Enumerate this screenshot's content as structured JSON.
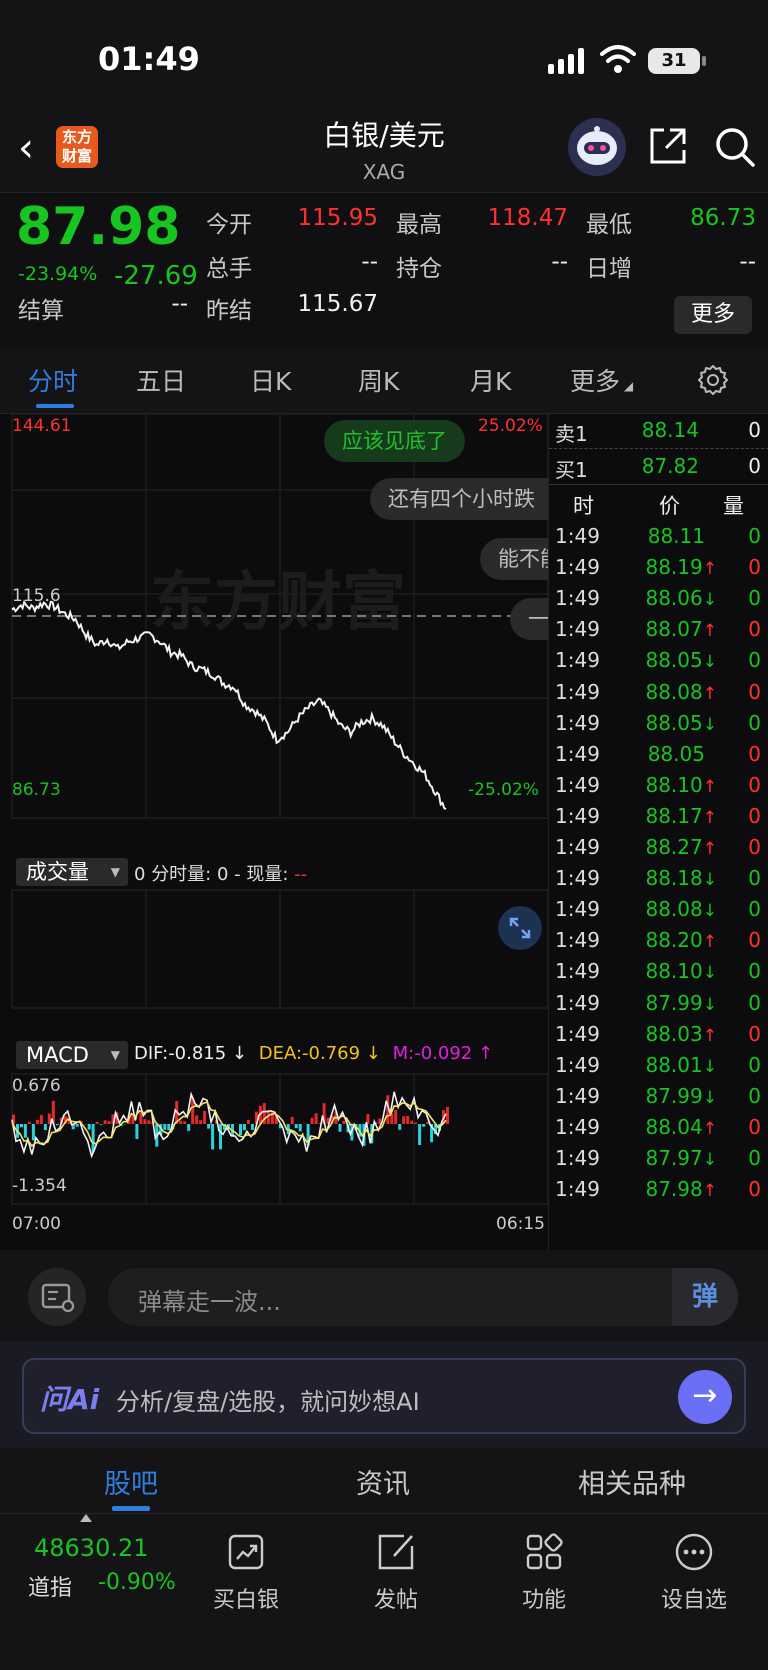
{
  "status_bar": {
    "time": "01:49",
    "battery": "31"
  },
  "header": {
    "logo_text": "东方财富",
    "title": "白银/美元",
    "subtitle": "XAG"
  },
  "quote": {
    "price": "87.98",
    "change_pct": "-23.94%",
    "change": "-27.69",
    "fields": {
      "open_label": "今开",
      "open": "115.95",
      "high_label": "最高",
      "high": "118.47",
      "low_label": "最低",
      "low": "86.73",
      "volume_label": "总手",
      "volume": "--",
      "oi_label": "持仓",
      "oi": "--",
      "daily_inc_label": "日增",
      "daily_inc": "--",
      "settle_label": "结算",
      "settle": "--",
      "prev_settle_label": "昨结",
      "prev_settle": "115.67"
    },
    "more_label": "更多"
  },
  "tabs": {
    "items": [
      "分时",
      "五日",
      "日K",
      "周K",
      "月K",
      "更多"
    ],
    "active": "分时"
  },
  "chart": {
    "top_price": "144.61",
    "top_pct": "25.02%",
    "ref_price": "115.6",
    "bottom_price": "86.73",
    "bottom_pct": "-25.02%",
    "watermark": "东方财富",
    "danmu": [
      "应该见底了",
      "还有四个小时跌",
      "能不能",
      "一"
    ],
    "volume_label": "成交量",
    "volume_info_prefix": "0",
    "volume_info_mid": "分时量: 0 - 现量:",
    "volume_info_now": "--",
    "macd_label": "MACD",
    "dif": "DIF:-0.815 ↓",
    "dea": "DEA:-0.769 ↓",
    "m": "M:-0.092 ↑",
    "macd_top": "0.676",
    "macd_bottom": "-1.354",
    "time_start": "07:00",
    "time_end": "06:15"
  },
  "chart_data": {
    "type": "line",
    "title": "",
    "xlabel": "",
    "ylabel": "",
    "x_range": [
      "07:00",
      "06:15"
    ],
    "ylim": [
      86.73,
      144.61
    ],
    "reference_price": 115.67,
    "series": [
      {
        "values": [
          116.6,
          117.3,
          116.8,
          117.5,
          117.0,
          116.0,
          115.2,
          113.0,
          111.5,
          112.3,
          111.0,
          112.0,
          112.5,
          113.0,
          112.0,
          110.5,
          110.0,
          108.5,
          108.0,
          107.3,
          106.0,
          105.5,
          103.0,
          102.0,
          100.5,
          98.0,
          99.0,
          101.0,
          102.5,
          103.5,
          102.0,
          100.0,
          99.0,
          100.5,
          101.0,
          100.0,
          98.0,
          96.0,
          94.5,
          93.0,
          90.5,
          88.0
        ]
      }
    ],
    "grid": true
  },
  "trades": {
    "ask_label": "卖1",
    "ask_price": "88.14",
    "ask_vol": "0",
    "bid_label": "买1",
    "bid_price": "87.82",
    "bid_vol": "0",
    "headers": [
      "时",
      "价",
      "量"
    ],
    "rows": [
      {
        "time": "1:49",
        "price": "88.11",
        "dir": "",
        "vol": "0",
        "vcolor": "green"
      },
      {
        "time": "1:49",
        "price": "88.19",
        "dir": "↑",
        "vol": "0",
        "vcolor": "red"
      },
      {
        "time": "1:49",
        "price": "88.06",
        "dir": "↓",
        "vol": "0",
        "vcolor": "green"
      },
      {
        "time": "1:49",
        "price": "88.07",
        "dir": "↑",
        "vol": "0",
        "vcolor": "red"
      },
      {
        "time": "1:49",
        "price": "88.05",
        "dir": "↓",
        "vol": "0",
        "vcolor": "green"
      },
      {
        "time": "1:49",
        "price": "88.08",
        "dir": "↑",
        "vol": "0",
        "vcolor": "red"
      },
      {
        "time": "1:49",
        "price": "88.05",
        "dir": "↓",
        "vol": "0",
        "vcolor": "green"
      },
      {
        "time": "1:49",
        "price": "88.05",
        "dir": "",
        "vol": "0",
        "vcolor": "red"
      },
      {
        "time": "1:49",
        "price": "88.10",
        "dir": "↑",
        "vol": "0",
        "vcolor": "red"
      },
      {
        "time": "1:49",
        "price": "88.17",
        "dir": "↑",
        "vol": "0",
        "vcolor": "red"
      },
      {
        "time": "1:49",
        "price": "88.27",
        "dir": "↑",
        "vol": "0",
        "vcolor": "red"
      },
      {
        "time": "1:49",
        "price": "88.18",
        "dir": "↓",
        "vol": "0",
        "vcolor": "green"
      },
      {
        "time": "1:49",
        "price": "88.08",
        "dir": "↓",
        "vol": "0",
        "vcolor": "green"
      },
      {
        "time": "1:49",
        "price": "88.20",
        "dir": "↑",
        "vol": "0",
        "vcolor": "red"
      },
      {
        "time": "1:49",
        "price": "88.10",
        "dir": "↓",
        "vol": "0",
        "vcolor": "green"
      },
      {
        "time": "1:49",
        "price": "87.99",
        "dir": "↓",
        "vol": "0",
        "vcolor": "green"
      },
      {
        "time": "1:49",
        "price": "88.03",
        "dir": "↑",
        "vol": "0",
        "vcolor": "red"
      },
      {
        "time": "1:49",
        "price": "88.01",
        "dir": "↓",
        "vol": "0",
        "vcolor": "green"
      },
      {
        "time": "1:49",
        "price": "87.99",
        "dir": "↓",
        "vol": "0",
        "vcolor": "green"
      },
      {
        "time": "1:49",
        "price": "88.04",
        "dir": "↑",
        "vol": "0",
        "vcolor": "red"
      },
      {
        "time": "1:49",
        "price": "87.97",
        "dir": "↓",
        "vol": "0",
        "vcolor": "green"
      },
      {
        "time": "1:49",
        "price": "87.98",
        "dir": "↑",
        "vol": "0",
        "vcolor": "red"
      }
    ]
  },
  "danmu_bar": {
    "placeholder": "弹幕走一波...",
    "button": "弹"
  },
  "ai_bar": {
    "logo": "问Ai",
    "placeholder": "分析/复盘/选股，就问妙想AI",
    "go": "→"
  },
  "lower_tabs": {
    "items": [
      "股吧",
      "资讯",
      "相关品种"
    ],
    "active": "股吧"
  },
  "bottom_nav": {
    "index_value": "48630.21",
    "index_name": "道指",
    "index_change": "-0.90%",
    "items": [
      "买白银",
      "发帖",
      "功能",
      "设自选"
    ]
  },
  "colors": {
    "up": "#ff3030",
    "down": "#18c41f",
    "accent": "#2f7dde",
    "ai": "#6a6ff5"
  }
}
